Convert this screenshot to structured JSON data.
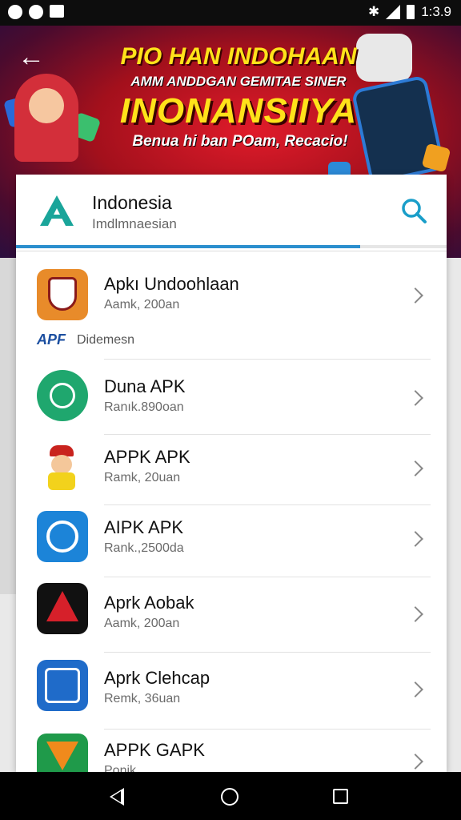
{
  "status_bar": {
    "time": "1:3.9"
  },
  "banner": {
    "line1": "PIO HAN INDOHAAN",
    "line2": "AMM ANDDGAN GEMITAE SINER",
    "line3": "INONANSIIYA",
    "line4": "Benua hi ban POam, Recacio!"
  },
  "search": {
    "title": "Indonesia",
    "subtitle": "Imdlmnaesian",
    "progress": 0.8
  },
  "items": [
    {
      "name": "Apkı Undoohlaan",
      "meta": "Aamk, 200an",
      "icon": "shield-app-icon",
      "color": "#e88b2a"
    },
    {
      "name": "Duna APK",
      "meta": "Ranık.890oan",
      "icon": "green-circle-app-icon",
      "color": "#1fa76e"
    },
    {
      "name": "APPK APK",
      "meta": "Ramk, 20uan",
      "icon": "cartoon-app-icon",
      "color": "#ffffff"
    },
    {
      "name": "AIPK APK",
      "meta": "Rank.,2500da",
      "icon": "blue-target-app-icon",
      "color": "#1c84d8"
    },
    {
      "name": "Aprk Aobak",
      "meta": "Aamk, 200an",
      "icon": "red-triangle-app-icon",
      "color": "#111111"
    },
    {
      "name": "Aprk Clehcap",
      "meta": "Remk, 36uan",
      "icon": "blue-a-app-icon",
      "color": "#1f6bc9"
    },
    {
      "name": "APPK GAPK",
      "meta": "Ponik",
      "icon": "green-orange-app-icon",
      "color": "#1f9a4a"
    }
  ],
  "sub_row": {
    "brand": "APF",
    "label": "Didemesn"
  }
}
